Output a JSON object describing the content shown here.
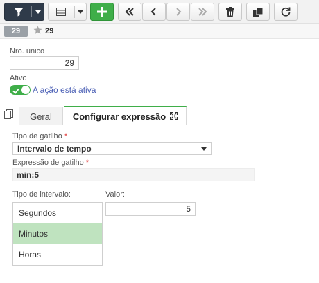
{
  "toolbar": {
    "buttons": [
      "filter-button",
      "grid-view-button",
      "add-button",
      "first-button",
      "previous-button",
      "next-button",
      "last-button",
      "delete-button",
      "copy-button",
      "refresh-button"
    ]
  },
  "record": {
    "badge": "29",
    "fav_number": "29"
  },
  "form": {
    "nro_label": "Nro. único",
    "nro_value": "29",
    "ativo_label": "Ativo",
    "ativo_text": "A ação está ativa"
  },
  "tabs": [
    {
      "label": "Geral"
    },
    {
      "label": "Configurar expressão"
    }
  ],
  "config": {
    "trigger_type_label": "Tipo de gatilho",
    "trigger_type_value": "Intervalo de tempo",
    "expression_label": "Expressão de gatilho",
    "expression_value": "min:5",
    "interval_type_label": "Tipo de intervalo:",
    "value_label": "Valor:",
    "value": "5",
    "required_mark": "*",
    "interval_options": [
      "Segundos",
      "Minutos",
      "Horas"
    ],
    "selected_option": "Minutos"
  },
  "colors": {
    "accent_green": "#3fae49",
    "toolbar_dark": "#2f3b4a",
    "selected_row": "#bfe3bf",
    "link_blue": "#4a5fb5"
  }
}
